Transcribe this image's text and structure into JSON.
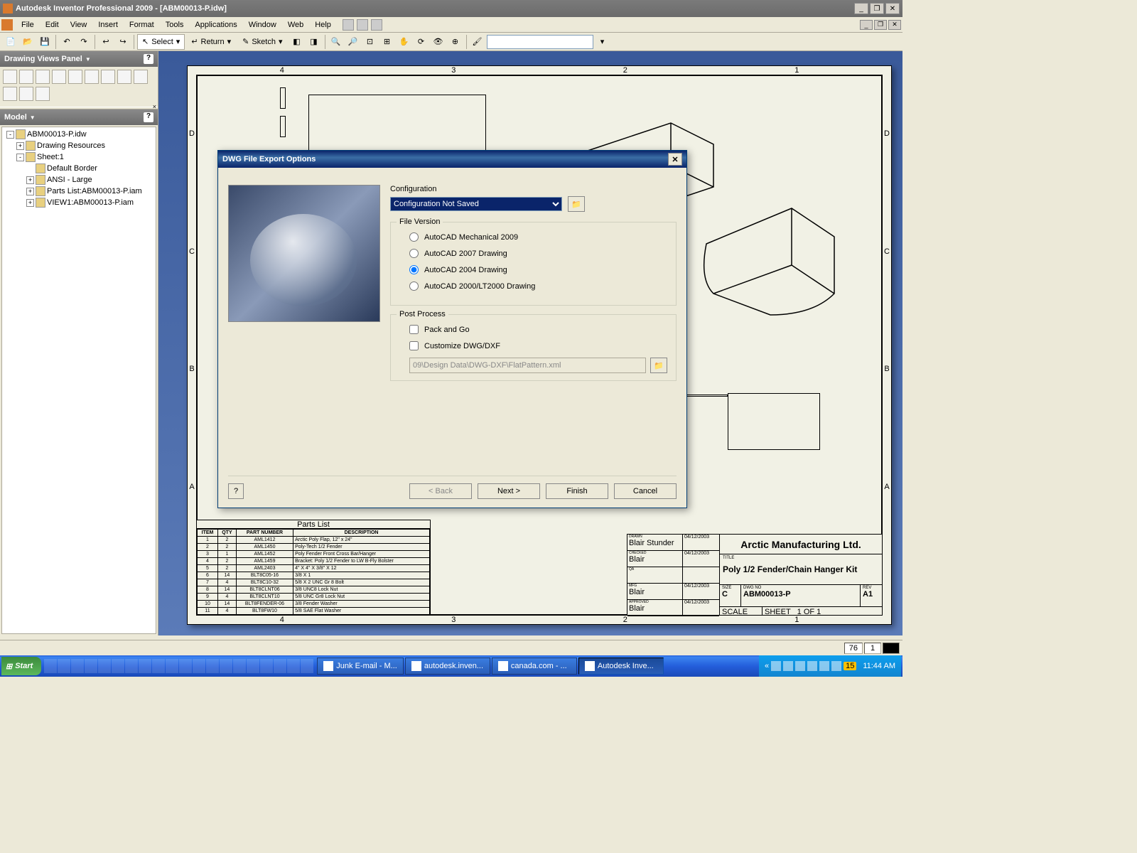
{
  "app": {
    "title": "Autodesk Inventor Professional 2009 - [ABM00013-P.idw]"
  },
  "menu": [
    "File",
    "Edit",
    "View",
    "Insert",
    "Format",
    "Tools",
    "Applications",
    "Window",
    "Web",
    "Help"
  ],
  "toolbar": {
    "select": "Select",
    "return": "Return",
    "sketch": "Sketch"
  },
  "panels": {
    "views": "Drawing Views Panel",
    "model": "Model"
  },
  "tree": [
    {
      "level": 1,
      "exp": "-",
      "label": "ABM00013-P.idw"
    },
    {
      "level": 2,
      "exp": "+",
      "label": "Drawing Resources"
    },
    {
      "level": 2,
      "exp": "-",
      "label": "Sheet:1"
    },
    {
      "level": 3,
      "exp": "",
      "label": "Default Border"
    },
    {
      "level": 3,
      "exp": "+",
      "label": "ANSI - Large"
    },
    {
      "level": 3,
      "exp": "+",
      "label": "Parts List:ABM00013-P.iam"
    },
    {
      "level": 3,
      "exp": "+",
      "label": "VIEW1:ABM00013-P.iam"
    }
  ],
  "ruler_top": [
    "4",
    "3",
    "2",
    "1"
  ],
  "ruler_left": [
    "D",
    "C",
    "B",
    "A"
  ],
  "titleblock": {
    "rows": [
      {
        "label": "DRAWN",
        "name": "Blair Stunder",
        "date": "04/12/2003"
      },
      {
        "label": "CHECKED",
        "name": "Blair",
        "date": "04/12/2003"
      },
      {
        "label": "QA",
        "name": "",
        "date": ""
      },
      {
        "label": "MFG",
        "name": "Blair",
        "date": "04/12/2003"
      },
      {
        "label": "APPROVED",
        "name": "Blair",
        "date": "04/12/2003"
      }
    ],
    "company": "Arctic Manufacturing Ltd.",
    "title_label": "TITLE",
    "title": "Poly 1/2 Fender/Chain Hanger Kit",
    "size_label": "SIZE",
    "size": "C",
    "dwgno_label": "DWG NO",
    "dwgno": "ABM00013-P",
    "rev_label": "REV",
    "rev": "A1",
    "scale_label": "SCALE",
    "sheet_label": "SHEET",
    "sheet": "1  OF  1"
  },
  "partslist": {
    "title": "Parts List",
    "headers": [
      "ITEM",
      "QTY",
      "PART NUMBER",
      "DESCRIPTION"
    ],
    "rows": [
      [
        "1",
        "2",
        "AML1412",
        "Arctic Poly Flap, 12\" x 24\""
      ],
      [
        "2",
        "2",
        "AML1450",
        "Poly-Tech 1/2 Fender"
      ],
      [
        "3",
        "1",
        "AML1452",
        "Poly Fender Front Cross Bar/Hanger"
      ],
      [
        "4",
        "2",
        "AML1459",
        "Bracket: Poly 1/2 Fender to LW B-Fly Bolster"
      ],
      [
        "5",
        "2",
        "AML2403",
        "4\" X 4\" X 3/8\" X 12"
      ],
      [
        "6",
        "14",
        "BLT8C05-16",
        "3/8 X 1"
      ],
      [
        "7",
        "4",
        "BLT8C10-32",
        "5/8 X 2 UNC Gr 8 Bolt"
      ],
      [
        "8",
        "14",
        "BLT8CLNT06",
        "3/8 UNC8 Lock Nut"
      ],
      [
        "9",
        "4",
        "BLT8CLNT10",
        "5/8 UNC Gr8 Lock Nut"
      ],
      [
        "10",
        "14",
        "BLT8FENDER-06",
        "3/8 Fender Washer"
      ],
      [
        "11",
        "4",
        "BLT8FW10",
        "5/8 SAE Flat Washer"
      ]
    ]
  },
  "dialog": {
    "title": "DWG File Export Options",
    "config_label": "Configuration",
    "config_value": "Configuration Not Saved",
    "fileversion_legend": "File Version",
    "versions": [
      "AutoCAD Mechanical 2009",
      "AutoCAD 2007 Drawing",
      "AutoCAD 2004 Drawing",
      "AutoCAD 2000/LT2000 Drawing"
    ],
    "version_selected": 2,
    "postprocess_legend": "Post Process",
    "pack_and_go": "Pack and Go",
    "customize": "Customize DWG/DXF",
    "custom_path": "09\\Design Data\\DWG-DXF\\FlatPattern.xml",
    "back": "< Back",
    "next": "Next >",
    "finish": "Finish",
    "cancel": "Cancel"
  },
  "statusbar": {
    "v1": "76",
    "v2": "1"
  },
  "taskbar": {
    "start": "Start",
    "tasks": [
      "Junk E-mail - M...",
      "autodesk.inven...",
      "canada.com - ...",
      "Autodesk Inve..."
    ],
    "tray_num": "15",
    "clock": "11:44 AM"
  }
}
